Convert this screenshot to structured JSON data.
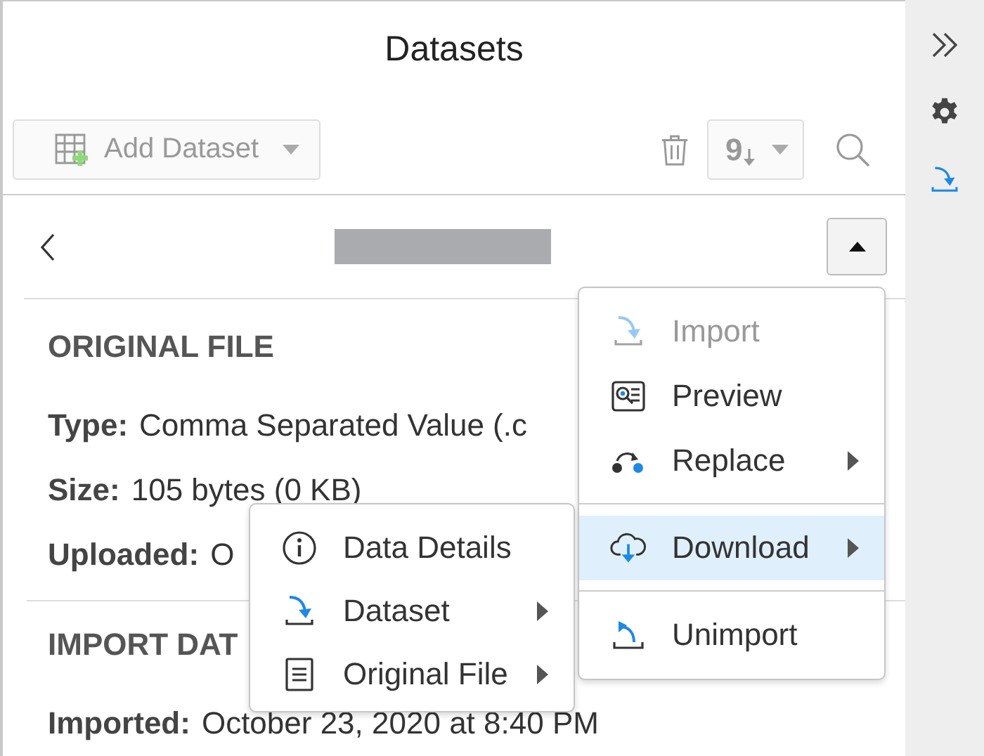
{
  "title": "Datasets",
  "toolbar": {
    "add_button": {
      "label": "Add Dataset",
      "disabled": true
    },
    "sort_button": {
      "label": "9"
    }
  },
  "detail": {
    "sections": [
      {
        "heading": "ORIGINAL FILE",
        "fields": [
          {
            "label": "Type:",
            "value": "Comma Separated Value (.c"
          },
          {
            "label": "Size:",
            "value": "105 bytes (0 KB)"
          },
          {
            "label": "Uploaded:",
            "value": "O"
          }
        ]
      },
      {
        "heading": "IMPORT DAT",
        "fields": [
          {
            "label": "Imported:",
            "value": "October 23, 2020 at 8:40 PM"
          }
        ]
      }
    ]
  },
  "menu": {
    "groups": [
      [
        {
          "kind": "import",
          "label": "Import",
          "disabled": true,
          "selected": false,
          "has_submenu": false
        },
        {
          "kind": "preview",
          "label": "Preview",
          "disabled": false,
          "selected": false,
          "has_submenu": false
        },
        {
          "kind": "replace",
          "label": "Replace",
          "disabled": false,
          "selected": false,
          "has_submenu": true
        }
      ],
      [
        {
          "kind": "download",
          "label": "Download",
          "disabled": false,
          "selected": true,
          "has_submenu": true
        }
      ],
      [
        {
          "kind": "unimport",
          "label": "Unimport",
          "disabled": false,
          "selected": false,
          "has_submenu": false
        }
      ]
    ]
  },
  "submenu": {
    "items": [
      {
        "kind": "info",
        "label": "Data Details",
        "has_submenu": false
      },
      {
        "kind": "dataset",
        "label": "Dataset",
        "has_submenu": true
      },
      {
        "kind": "document",
        "label": "Original File",
        "has_submenu": true
      }
    ]
  }
}
